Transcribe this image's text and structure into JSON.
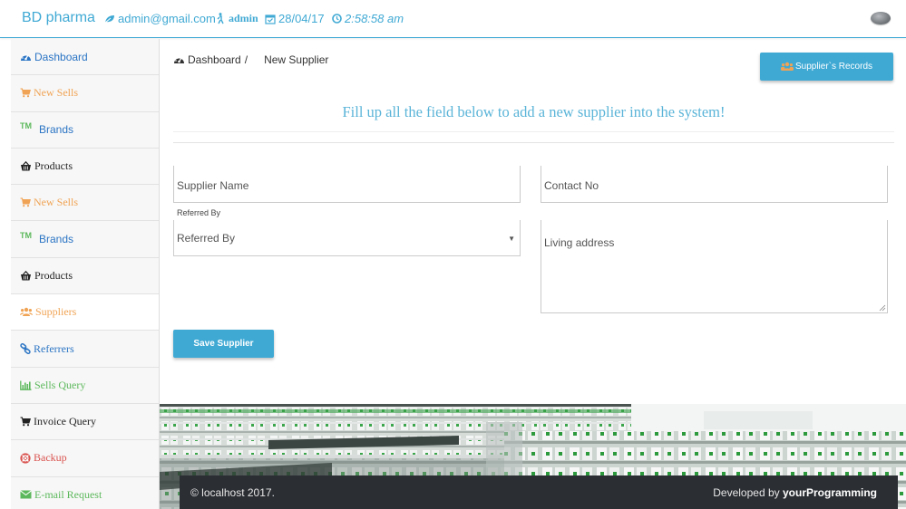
{
  "topbar": {
    "brand": "BD pharma",
    "email": "admin@gmail.com",
    "user": "admin",
    "date": "28/04/17",
    "time": "2:58:58 am"
  },
  "sidebar": {
    "items": [
      {
        "label": "Dashboard",
        "icon": "dashboard-icon"
      },
      {
        "label": "New Sells",
        "icon": "cart-icon"
      },
      {
        "label": "Brands",
        "icon": "trademark-icon",
        "prefix": "TM"
      },
      {
        "label": "Products",
        "icon": "basket-icon"
      },
      {
        "label": "New Sells",
        "icon": "cart-icon"
      },
      {
        "label": "Brands",
        "icon": "trademark-icon",
        "prefix": "TM"
      },
      {
        "label": "Products",
        "icon": "basket-icon"
      },
      {
        "label": "Suppliers",
        "icon": "users-icon"
      },
      {
        "label": "Referrers",
        "icon": "link-icon"
      },
      {
        "label": "Sells Query",
        "icon": "bar-chart-icon"
      },
      {
        "label": "Invoice Query",
        "icon": "cart-icon"
      },
      {
        "label": "Backup",
        "icon": "lifebuoy-icon"
      },
      {
        "label": "E-mail Request",
        "icon": "envelope-icon"
      }
    ]
  },
  "main": {
    "breadcrumb": {
      "root": "Dashboard",
      "separator": "/",
      "current": "New Supplier"
    },
    "records_button": "Supplier`s Records",
    "heading": "Fill up all the field below to add a new supplier into the system!",
    "form": {
      "supplier_name_placeholder": "Supplier Name",
      "contact_placeholder": "Contact No",
      "referred_label": "Referred By",
      "referred_selected": "Referred By",
      "address_placeholder": "Living address",
      "save_label": "Save Supplier"
    }
  },
  "footer": {
    "copyright": "© localhost 2017.",
    "developed_prefix": "Developed by",
    "developer": "yourProgramming"
  },
  "colors": {
    "accent": "#3fa9d4",
    "footer_bg": "#2b2e33",
    "orange": "#f0a354",
    "green": "#5cb85c",
    "red": "#d9534f"
  }
}
